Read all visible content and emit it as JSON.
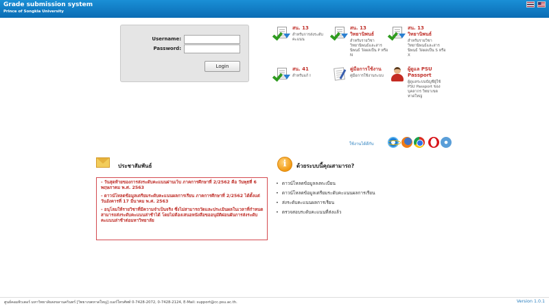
{
  "header": {
    "title": "Grade submission system",
    "subtitle": "Prince of Songkla University",
    "flags": [
      "thai-flag",
      "us-flag"
    ]
  },
  "login": {
    "username_label": "Username:",
    "password_label": "Password:",
    "username_value": "",
    "password_value": "",
    "button_label": "Login"
  },
  "links": [
    {
      "title": "สน. 13",
      "desc": "สำหรับการส่งระดับคะแนน",
      "icon": "document-check-icon"
    },
    {
      "title": "สน. 13 วิทยานิพนธ์",
      "desc": "สำหรับรายวิชาวิทยานิพนธ์และสารนิพนธ์ วัดผลเป็น P หรือ N",
      "icon": "document-check-icon"
    },
    {
      "title": "สน. 13 วิทยานิพนธ์",
      "desc": "สำหรับรายวิชาวิทยานิพนธ์และสารนิพนธ์ วัดผลเป็น S หรือ X",
      "icon": "document-check-icon"
    },
    {
      "title": "สน. 41",
      "desc": "สำหรับแก้ I",
      "icon": "document-check-icon"
    },
    {
      "title": "คู่มือการใช้งาน",
      "desc": "คู่มือการใช้งานระบบ",
      "icon": "manual-icon"
    },
    {
      "title": "ผู้ดูแล PSU Passport",
      "desc": "ผู้ดูแลระบบบัญชีผู้ใช้ PSU Passport ของบุคลากร วิทยาเขตหาดใหญ่",
      "icon": "user-admin-icon"
    }
  ],
  "browsers": {
    "label": "ใช้งานได้ดีกับ",
    "items": [
      "internet-explorer-icon",
      "firefox-icon",
      "chrome-icon",
      "opera-icon",
      "safari-icon"
    ]
  },
  "pr": {
    "title": "ประชาสัมพันธ์",
    "news": [
      "- วันสุดท้ายของการส่งระดับคะแนนผ่านเว็บ ภาคการศึกษาที่ 2/2562 คือ วันพุธที่ 6 พฤษภาคม พ.ศ. 2563",
      "- ดาวน์โหลดข้อมูลเตรียมระดับคะแนนผลการเรียน ภาคการศึกษาที่ 2/2562 ได้ตั้งแต่วันอังคารที่ 17 มีนาคม พ.ศ. 2563",
      "- อนุโลมให้รายวิชาที่มีความจำเป็นจริง ซึ่งไม่สามารถวัดและประเมินผลในเวลาที่กำหนดสามารถส่งระดับคะแนนล่าช้าได้ โดยไม่ต้องเสนอหนังสือขออนุมัติผ่อนผันการส่งระดับคะแนนล่าช้าต่อมหาวิทยาลัย"
    ]
  },
  "help": {
    "title": "ด้วยระบบนี้คุณสามารถ?",
    "items": [
      "ดาวน์โหลดข้อมูลลงทะเบียน",
      "ดาวน์โหลดข้อมูลเตรียมระดับคะแนนผลการเรียน",
      "ส่งระดับคะแนนผลการเรียน",
      "ตรวจสอบระดับคะแนนที่ส่งแล้ว"
    ]
  },
  "footer": {
    "text": "ศูนย์คอมพิวเตอร์ มหาวิทยาลัยสงขลานครินทร์ [วิทยาเขตหาดใหญ่]  เบอร์โทรศัพท์ 0-7428-2072, 0-7428-2124, E-Mail: support@cc.psu.ac.th.",
    "version": "Version 1.0.1"
  }
}
